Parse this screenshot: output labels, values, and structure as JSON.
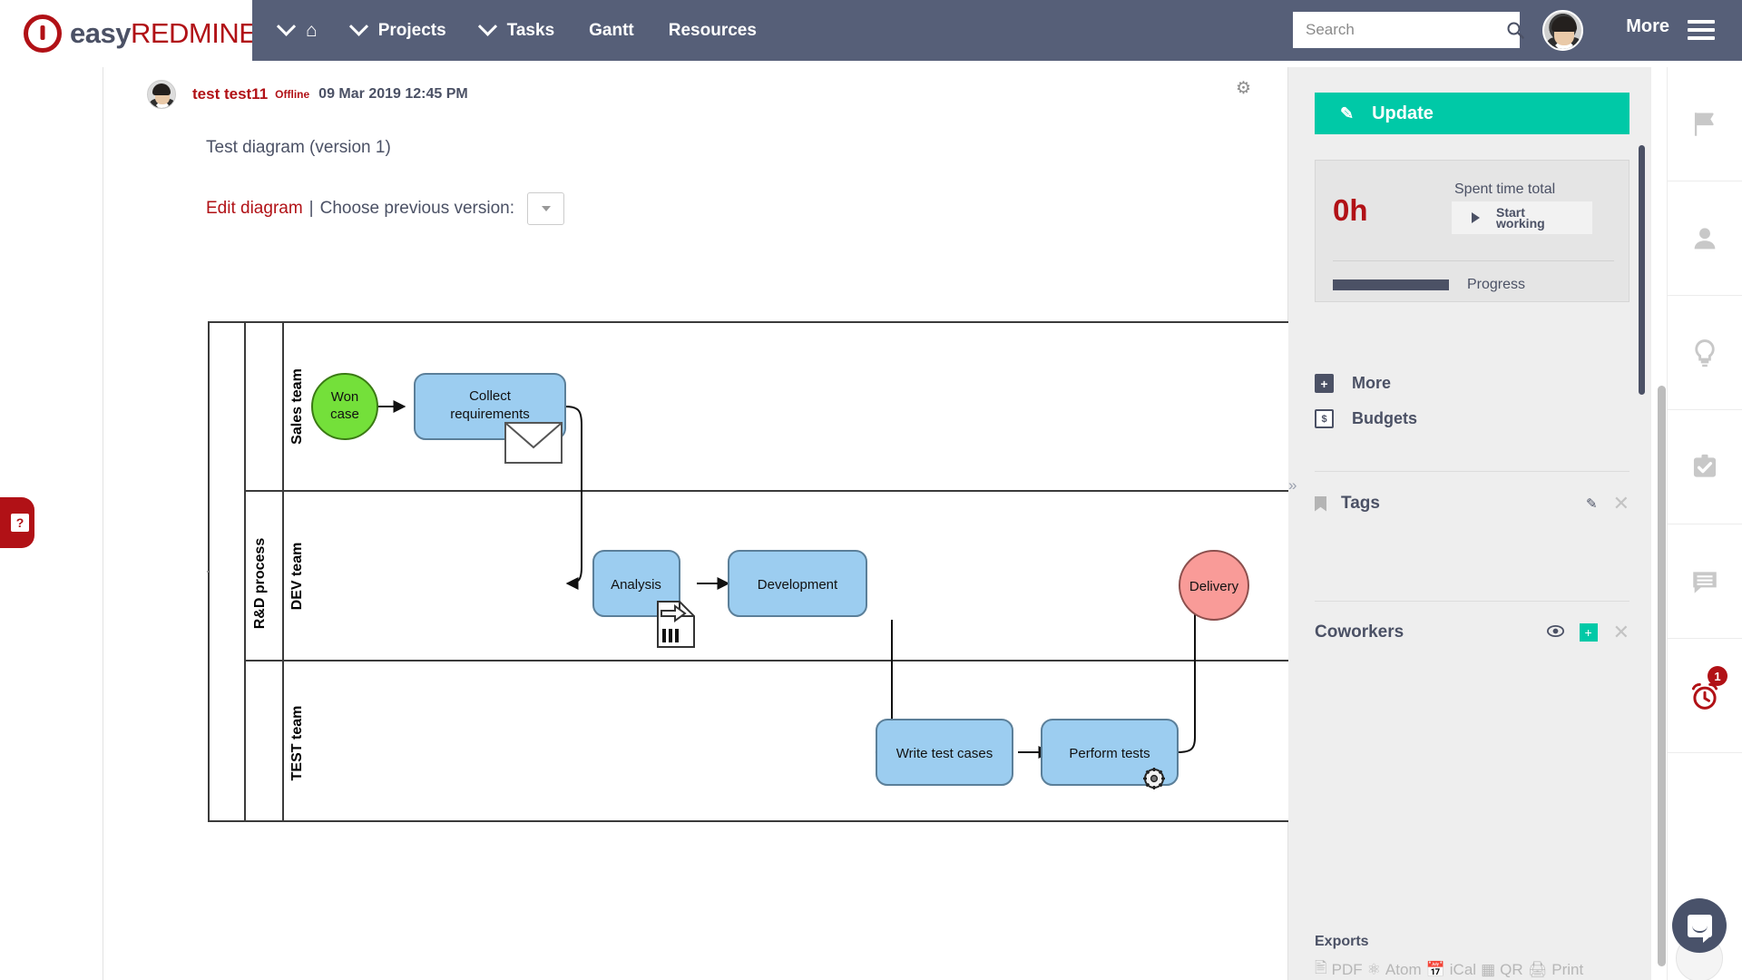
{
  "brand": {
    "easy": "easy",
    "redmine": "REDMINE"
  },
  "nav": {
    "items": [
      {
        "label": "",
        "icon": "home-icon",
        "has_chevron": true
      },
      {
        "label": "Projects",
        "icon": "",
        "has_chevron": true
      },
      {
        "label": "Tasks",
        "icon": "",
        "has_chevron": true
      },
      {
        "label": "Gantt",
        "icon": "",
        "has_chevron": false
      },
      {
        "label": "Resources",
        "icon": "",
        "has_chevron": false
      }
    ],
    "more_label": "More"
  },
  "search": {
    "placeholder": "Search",
    "icon": "search-icon"
  },
  "journal": {
    "author": "test test11",
    "status": "Offline",
    "date": "09 Mar 2019 12:45 PM",
    "gear_icon": "gear-icon"
  },
  "diagram_block": {
    "title": "Test diagram (version 1)",
    "edit_link": "Edit diagram",
    "separator": "|",
    "choose_version_label": "Choose previous version:",
    "version_value": ""
  },
  "chart_data": {
    "type": "diagram",
    "title": "Test diagram (version 1)",
    "notation": "BPMN swimlane process",
    "pool_label": "R&D process",
    "lanes": [
      {
        "label": "Sales team",
        "nodes": [
          "Won case",
          "Collect requirements"
        ]
      },
      {
        "label": "DEV team",
        "nodes": [
          "Analysis",
          "Development",
          "Delivery"
        ]
      },
      {
        "label": "TEST team",
        "nodes": [
          "Write test cases",
          "Perform tests"
        ]
      }
    ],
    "nodes": [
      {
        "id": "won_case",
        "label": "Won case",
        "shape": "circle",
        "fill": "#74e03a",
        "lane": "Sales team"
      },
      {
        "id": "collect",
        "label": "Collect requirements",
        "shape": "task",
        "fill": "#9ccdf0",
        "lane": "Sales team",
        "marker": "message-envelope"
      },
      {
        "id": "analysis",
        "label": "Analysis",
        "shape": "task",
        "fill": "#9ccdf0",
        "lane": "DEV team",
        "marker": "document"
      },
      {
        "id": "development",
        "label": "Development",
        "shape": "task",
        "fill": "#9ccdf0",
        "lane": "DEV team"
      },
      {
        "id": "write_tests",
        "label": "Write test cases",
        "shape": "task",
        "fill": "#9ccdf0",
        "lane": "TEST team"
      },
      {
        "id": "perform_tests",
        "label": "Perform tests",
        "shape": "task",
        "fill": "#9ccdf0",
        "lane": "TEST team",
        "marker": "gear"
      },
      {
        "id": "delivery",
        "label": "Delivery",
        "shape": "circle",
        "fill": "#f99b98",
        "lane": "DEV team"
      }
    ],
    "edges": [
      {
        "from": "won_case",
        "to": "collect"
      },
      {
        "from": "collect",
        "to": "analysis"
      },
      {
        "from": "analysis",
        "to": "development"
      },
      {
        "from": "development",
        "to": "write_tests"
      },
      {
        "from": "write_tests",
        "to": "perform_tests"
      },
      {
        "from": "perform_tests",
        "to": "delivery"
      }
    ]
  },
  "panel": {
    "update_label": "Update",
    "spent_hours": "0h",
    "spent_time_label": "Spent time total",
    "start_working_line1": "Start",
    "start_working_line2": "working",
    "progress_label": "Progress",
    "links": [
      {
        "label": "More",
        "icon": "plus-square-icon"
      },
      {
        "label": "Budgets",
        "icon": "dollar-square-icon"
      }
    ],
    "tags_title": "Tags",
    "coworkers_title": "Coworkers",
    "collapse_icon": "chevron-right-icon"
  },
  "exports": {
    "title": "Exports",
    "items": [
      {
        "label": "PDF",
        "icon": "pdf-icon"
      },
      {
        "label": "Atom",
        "icon": "atom-icon"
      },
      {
        "label": "iCal",
        "icon": "calendar-icon"
      },
      {
        "label": "QR",
        "icon": "qr-icon"
      },
      {
        "label": "Print",
        "icon": "printer-icon"
      }
    ]
  },
  "rail": {
    "items": [
      {
        "name": "flag-icon",
        "badge": ""
      },
      {
        "name": "user-icon",
        "badge": ""
      },
      {
        "name": "lightbulb-icon",
        "badge": ""
      },
      {
        "name": "clipboard-check-icon",
        "badge": ""
      },
      {
        "name": "chat-icon",
        "badge": ""
      },
      {
        "name": "alarm-clock-icon",
        "badge": "1"
      }
    ]
  },
  "help_tab": {
    "glyph": "?"
  },
  "colors": {
    "navbar": "#565f78",
    "brand_red": "#b11116",
    "accent_green": "#00c9a7",
    "task_blue": "#9ccdf0",
    "start_green": "#74e03a",
    "end_red": "#f99b98"
  }
}
